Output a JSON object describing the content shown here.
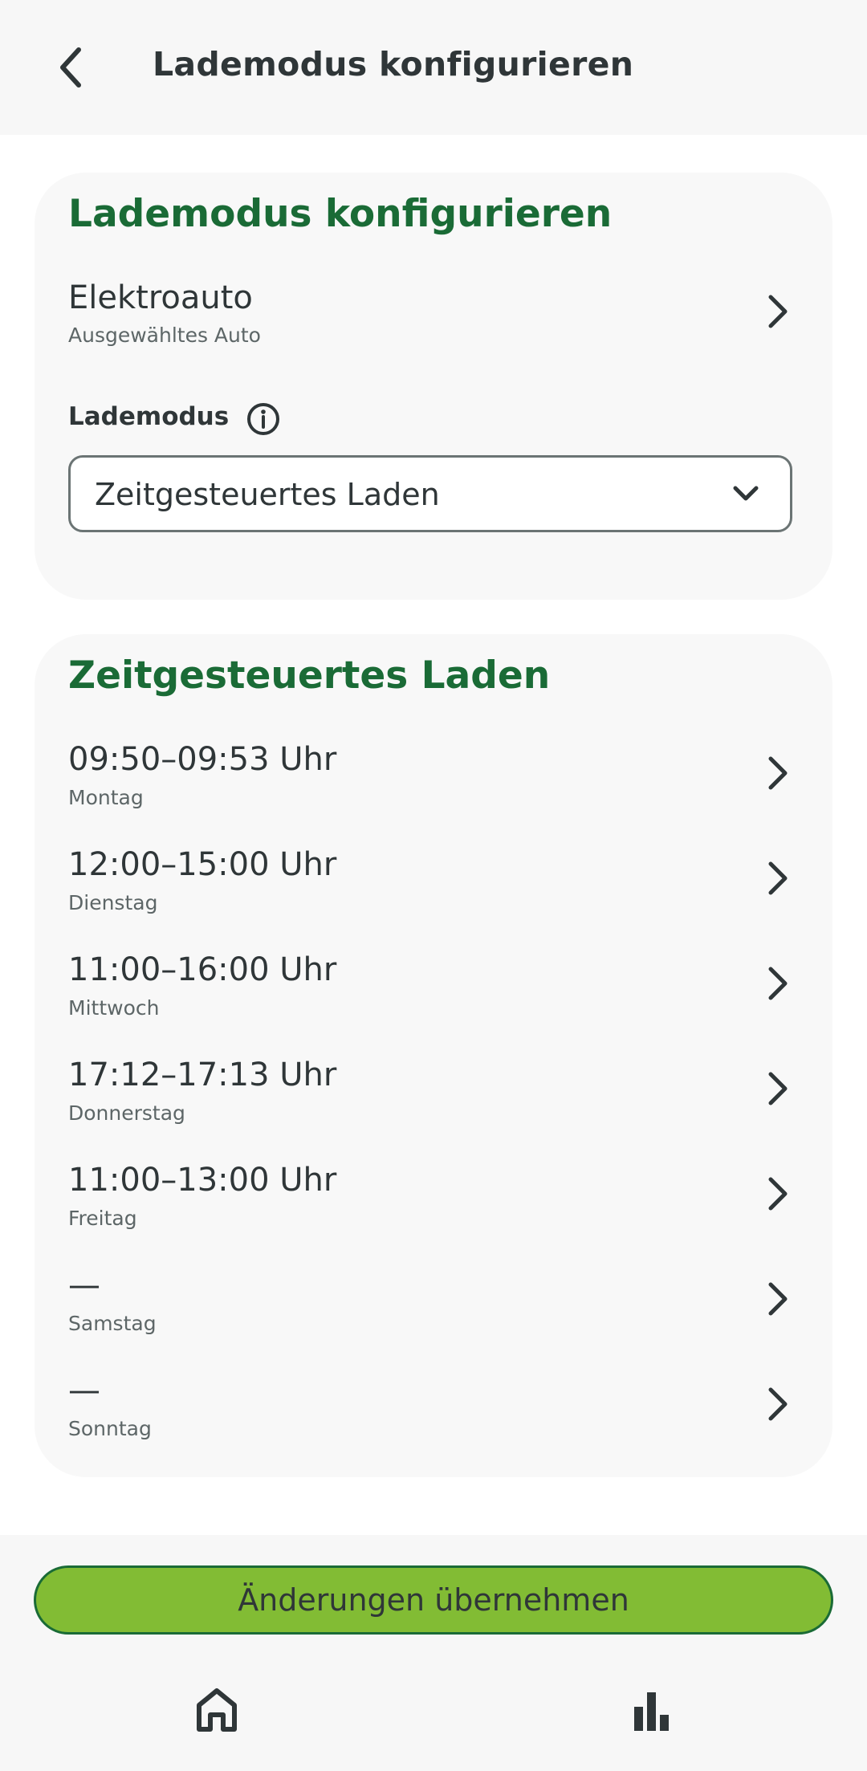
{
  "header": {
    "title": "Lademodus konfigurieren",
    "back_icon": "back-arrow-icon"
  },
  "config_card": {
    "title": "Lademodus konfigurieren",
    "car": {
      "name": "Elektroauto",
      "caption": "Ausgewähltes Auto"
    },
    "mode_label": "Lademodus",
    "info_icon": "info-icon",
    "mode_select": {
      "value": "Zeitgesteuertes Laden"
    }
  },
  "schedule_card": {
    "title": "Zeitgesteuertes Laden",
    "days": [
      {
        "time": "09:50–09:53 Uhr",
        "day": "Montag"
      },
      {
        "time": "12:00–15:00 Uhr",
        "day": "Dienstag"
      },
      {
        "time": "11:00–16:00 Uhr",
        "day": "Mittwoch"
      },
      {
        "time": "17:12–17:13 Uhr",
        "day": "Donnerstag"
      },
      {
        "time": "11:00–13:00 Uhr",
        "day": "Freitag"
      },
      {
        "time": "—",
        "day": "Samstag"
      },
      {
        "time": "—",
        "day": "Sonntag"
      }
    ]
  },
  "footer": {
    "apply_label": "Änderungen übernehmen",
    "nav": [
      {
        "icon": "home-icon"
      },
      {
        "icon": "bar-chart-icon"
      }
    ]
  },
  "colors": {
    "accent_green": "#1a6b36",
    "button_green": "#82bc34",
    "text_dark": "#2f3638",
    "card_bg": "#f8f8f8"
  }
}
